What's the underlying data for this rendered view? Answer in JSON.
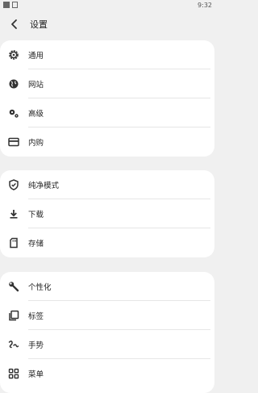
{
  "status_bar": {
    "time": "9:32"
  },
  "header": {
    "title": "设置"
  },
  "groups": [
    {
      "items": [
        {
          "label": "通用",
          "icon": "gear-icon"
        },
        {
          "label": "网站",
          "icon": "globe-icon"
        },
        {
          "label": "高级",
          "icon": "gears-icon"
        },
        {
          "label": "内购",
          "icon": "credit-card-icon"
        }
      ]
    },
    {
      "items": [
        {
          "label": "纯净模式",
          "icon": "shield-icon"
        },
        {
          "label": "下载",
          "icon": "download-icon"
        },
        {
          "label": "存储",
          "icon": "sd-card-icon"
        }
      ]
    },
    {
      "items": [
        {
          "label": "个性化",
          "icon": "wrench-icon"
        },
        {
          "label": "标签",
          "icon": "tabs-icon"
        },
        {
          "label": "手势",
          "icon": "gesture-icon"
        },
        {
          "label": "菜单",
          "icon": "grid-icon"
        }
      ]
    }
  ]
}
